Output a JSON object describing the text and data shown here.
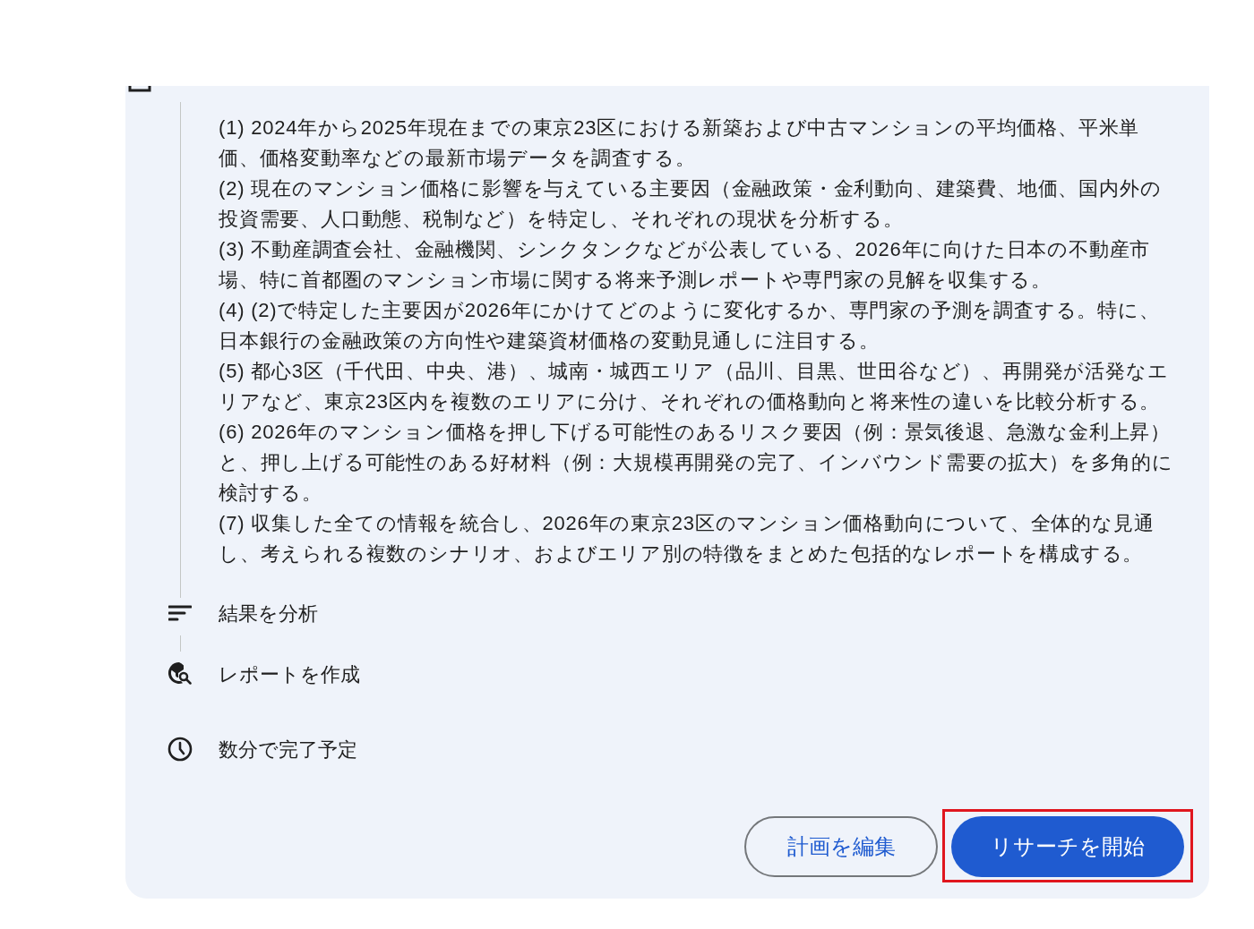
{
  "plan": {
    "items": [
      "(1) 2024年から2025年現在までの東京23区における新築および中古マンションの平均価格、平米単価、価格変動率などの最新市場データを調査する。",
      "(2) 現在のマンション価格に影響を与えている主要因（金融政策・金利動向、建築費、地価、国内外の投資需要、人口動態、税制など）を特定し、それぞれの現状を分析する。",
      "(3) 不動産調査会社、金融機関、シンクタンクなどが公表している、2026年に向けた日本の不動産市場、特に首都圏のマンション市場に関する将来予測レポートや専門家の見解を収集する。",
      "(4) (2)で特定した主要因が2026年にかけてどのように変化するか、専門家の予測を調査する。特に、日本銀行の金融政策の方向性や建築資材価格の変動見通しに注目する。",
      "(5) 都心3区（千代田、中央、港）、城南・城西エリア（品川、目黒、世田谷など）、再開発が活発なエリアなど、東京23区内を複数のエリアに分け、それぞれの価格動向と将来性の違いを比較分析する。",
      "(6) 2026年のマンション価格を押し下げる可能性のあるリスク要因（例：景気後退、急激な金利上昇）と、押し上げる可能性のある好材料（例：大規模再開発の完了、インバウンド需要の拡大）を多角的に検討する。",
      "(7) 収集した全ての情報を統合し、2026年の東京23区のマンション価格動向について、全体的な見通し、考えられる複数のシナリオ、およびエリア別の特徴をまとめた包括的なレポートを構成する。"
    ]
  },
  "steps": [
    {
      "kind": "analyze",
      "label": "結果を分析"
    },
    {
      "kind": "report",
      "label": "レポートを作成"
    }
  ],
  "eta": "数分で完了予定",
  "buttons": [
    {
      "kind": "outline",
      "label": "計画を編集",
      "highlighted": false
    },
    {
      "kind": "primary",
      "label": "リサーチを開始",
      "highlighted": true
    }
  ]
}
